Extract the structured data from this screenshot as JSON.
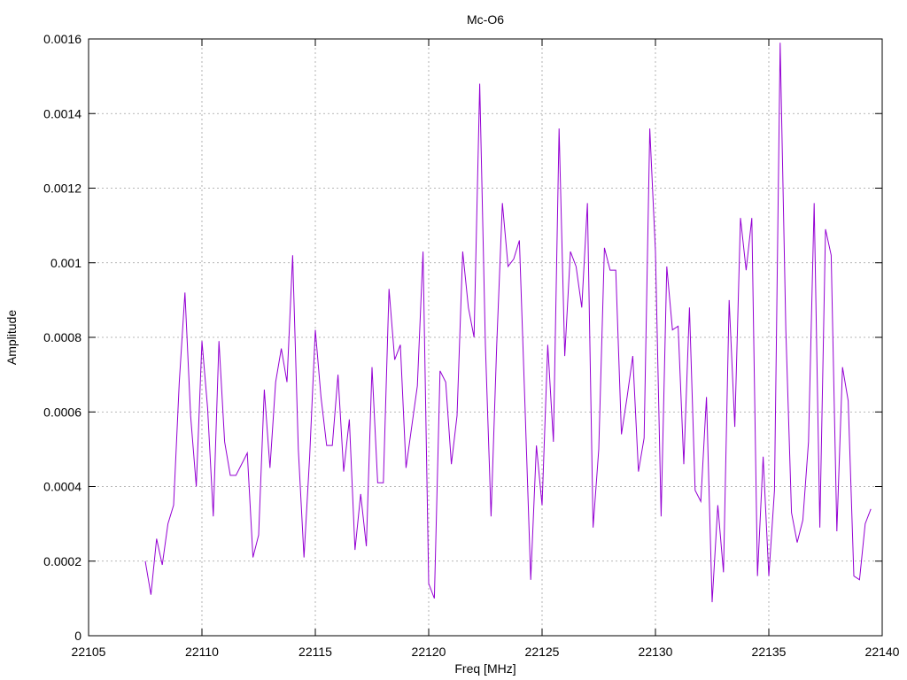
{
  "chart_data": {
    "type": "line",
    "title": "Mc-O6",
    "xlabel": "Freq [MHz]",
    "ylabel": "Amplitude",
    "xlim": [
      22105,
      22140
    ],
    "ylim": [
      0,
      0.0016
    ],
    "grid": true,
    "xticks": [
      "22105",
      "22110",
      "22115",
      "22120",
      "22125",
      "22130",
      "22135",
      "22140"
    ],
    "xtick_values": [
      22105,
      22110,
      22115,
      22120,
      22125,
      22130,
      22135,
      22140
    ],
    "yticks": [
      "0",
      "0.0002",
      "0.0004",
      "0.0006",
      "0.0008",
      "0.001",
      "0.0012",
      "0.0014",
      "0.0016"
    ],
    "ytick_values": [
      0,
      0.0002,
      0.0004,
      0.0006,
      0.0008,
      0.001,
      0.0012,
      0.0014,
      0.0016
    ],
    "series": [
      {
        "color": "#9400d3",
        "x": [
          22107.5,
          22107.75,
          22108.0,
          22108.25,
          22108.5,
          22108.75,
          22109.0,
          22109.25,
          22109.5,
          22109.75,
          22110.0,
          22110.25,
          22110.5,
          22110.75,
          22111.0,
          22111.25,
          22111.5,
          22111.75,
          22112.0,
          22112.25,
          22112.5,
          22112.75,
          22113.0,
          22113.25,
          22113.5,
          22113.75,
          22114.0,
          22114.25,
          22114.5,
          22114.75,
          22115.0,
          22115.25,
          22115.5,
          22115.75,
          22116.0,
          22116.25,
          22116.5,
          22116.75,
          22117.0,
          22117.25,
          22117.5,
          22117.75,
          22118.0,
          22118.25,
          22118.5,
          22118.75,
          22119.0,
          22119.25,
          22119.5,
          22119.75,
          22120.0,
          22120.25,
          22120.5,
          22120.75,
          22121.0,
          22121.25,
          22121.5,
          22121.75,
          22122.0,
          22122.25,
          22122.5,
          22122.75,
          22123.0,
          22123.25,
          22123.5,
          22123.75,
          22124.0,
          22124.25,
          22124.5,
          22124.75,
          22125.0,
          22125.25,
          22125.5,
          22125.75,
          22126.0,
          22126.25,
          22126.5,
          22126.75,
          22127.0,
          22127.25,
          22127.5,
          22127.75,
          22128.0,
          22128.25,
          22128.5,
          22128.75,
          22129.0,
          22129.25,
          22129.5,
          22129.75,
          22130.0,
          22130.25,
          22130.5,
          22130.75,
          22131.0,
          22131.25,
          22131.5,
          22131.75,
          22132.0,
          22132.25,
          22132.5,
          22132.75,
          22133.0,
          22133.25,
          22133.5,
          22133.75,
          22134.0,
          22134.25,
          22134.5,
          22134.75,
          22135.0,
          22135.25,
          22135.5,
          22135.75,
          22136.0,
          22136.25,
          22136.5,
          22136.75,
          22137.0,
          22137.25,
          22137.5,
          22137.75,
          22138.0,
          22138.25,
          22138.5,
          22138.75,
          22139.0,
          22139.25,
          22139.5
        ],
        "y": [
          0.0002,
          0.00011,
          0.00026,
          0.00019,
          0.0003,
          0.00035,
          0.00068,
          0.00092,
          0.00059,
          0.0004,
          0.00079,
          0.00061,
          0.00032,
          0.00079,
          0.00052,
          0.00043,
          0.00043,
          0.00046,
          0.00049,
          0.00021,
          0.00027,
          0.00066,
          0.00045,
          0.00068,
          0.00077,
          0.00068,
          0.00102,
          0.0005,
          0.00021,
          0.00048,
          0.00082,
          0.00064,
          0.00051,
          0.00051,
          0.0007,
          0.00044,
          0.00058,
          0.00023,
          0.00038,
          0.00024,
          0.00072,
          0.00041,
          0.00041,
          0.00093,
          0.00074,
          0.00078,
          0.00045,
          0.00056,
          0.00067,
          0.00103,
          0.00014,
          0.0001,
          0.00071,
          0.00068,
          0.00046,
          0.00059,
          0.00103,
          0.00088,
          0.0008,
          0.00148,
          0.00078,
          0.00032,
          0.00078,
          0.00116,
          0.00099,
          0.00101,
          0.00106,
          0.00061,
          0.00015,
          0.00051,
          0.00035,
          0.00078,
          0.00052,
          0.00136,
          0.00075,
          0.00103,
          0.00099,
          0.00088,
          0.00116,
          0.00029,
          0.0005,
          0.00104,
          0.00098,
          0.00098,
          0.00054,
          0.00064,
          0.00075,
          0.00044,
          0.00053,
          0.00136,
          0.00103,
          0.00032,
          0.00099,
          0.00082,
          0.00083,
          0.00046,
          0.00088,
          0.00039,
          0.00036,
          0.00064,
          9e-05,
          0.00035,
          0.00017,
          0.0009,
          0.00056,
          0.00112,
          0.00098,
          0.00112,
          0.00016,
          0.00048,
          0.00016,
          0.00039,
          0.00159,
          0.00082,
          0.00033,
          0.00025,
          0.00031,
          0.00052,
          0.00116,
          0.00029,
          0.00109,
          0.00102,
          0.00028,
          0.00072,
          0.00063,
          0.00016,
          0.00015,
          0.0003,
          0.00034
        ]
      }
    ]
  }
}
